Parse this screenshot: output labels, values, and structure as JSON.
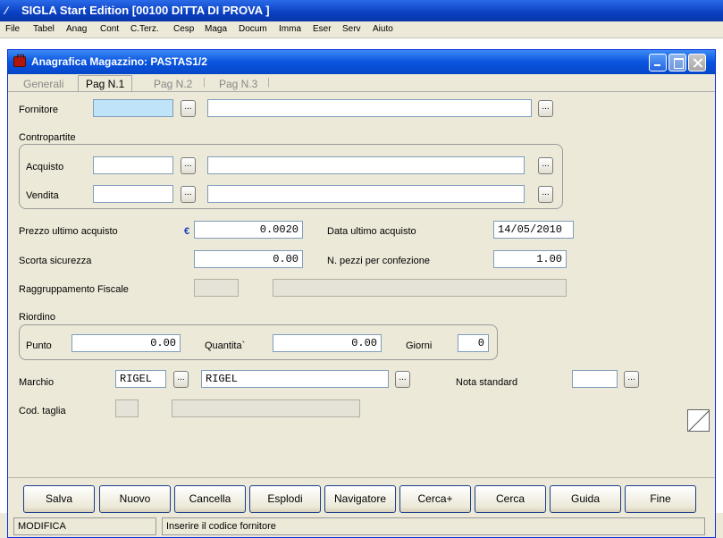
{
  "app": {
    "title": "SIGLA Start Edition [00100 DITTA DI PROVA                    ]",
    "icon": "sigla-logo-icon"
  },
  "menu": [
    "File",
    "Tabel",
    "Anag",
    "Cont",
    "C.Terz.",
    "Cesp",
    "Maga",
    "Docum",
    "Imma",
    "Eser",
    "Serv",
    "Aiuto"
  ],
  "window": {
    "title": "Anagrafica Magazzino: PASTAS1/2",
    "icon": "briefcase-icon"
  },
  "tabs": [
    {
      "label": "Generali",
      "active": false
    },
    {
      "label": "Pag N.1",
      "active": true
    },
    {
      "label": "Pag N.2",
      "active": false
    },
    {
      "label": "Pag N.3",
      "active": false
    }
  ],
  "tab_separator": "|",
  "form": {
    "fornitore": {
      "label": "Fornitore",
      "code": "",
      "desc": ""
    },
    "contropartite": {
      "label": "Contropartite",
      "acquisto": {
        "label": "Acquisto",
        "code": "",
        "desc": ""
      },
      "vendita": {
        "label": "Vendita",
        "code": "",
        "desc": ""
      }
    },
    "prezzo_ultimo_acquisto": {
      "label": "Prezzo ultimo acquisto",
      "currency": "€",
      "value": "0.0020"
    },
    "data_ultimo_acquisto": {
      "label": "Data ultimo acquisto",
      "value": "14/05/2010"
    },
    "scorta_sicurezza": {
      "label": "Scorta sicurezza",
      "value": "0.00"
    },
    "pezzi_confezione": {
      "label": "N. pezzi per confezione",
      "value": "1.00"
    },
    "raggruppamento_fiscale": {
      "label": "Raggruppamento Fiscale",
      "code": "",
      "desc": ""
    },
    "riordino": {
      "label": "Riordino",
      "punto": {
        "label": "Punto",
        "value": "0.00"
      },
      "quantita": {
        "label": "Quantita`",
        "value": "0.00"
      },
      "giorni": {
        "label": "Giorni",
        "value": "0"
      }
    },
    "marchio": {
      "label": "Marchio",
      "code": "RIGEL",
      "desc": "RIGEL"
    },
    "nota_standard": {
      "label": "Nota standard",
      "value": ""
    },
    "cod_taglia": {
      "label": "Cod. taglia",
      "code": "",
      "desc": ""
    },
    "ellipsis": "..."
  },
  "buttons": [
    "Salva",
    "Nuovo",
    "Cancella",
    "Esplodi",
    "Navigatore",
    "Cerca+",
    "Cerca",
    "Guida",
    "Fine"
  ],
  "status": {
    "mode": "MODIFICA",
    "message": "Inserire il codice fornitore"
  },
  "colors": {
    "titlebar": "#0a3fc2",
    "window_title": "#0a55e0",
    "background": "#ece9d8",
    "focused_field": "#bfe3f8",
    "euro": "#1a3ec2"
  }
}
